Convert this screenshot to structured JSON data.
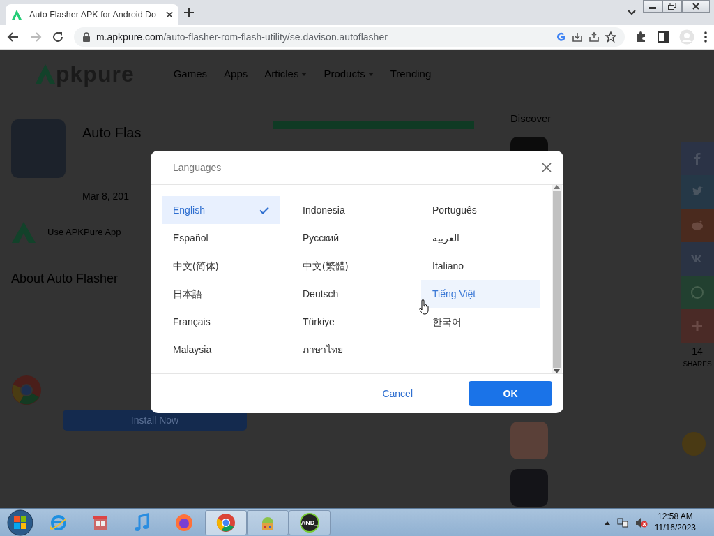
{
  "browser": {
    "tab_title": "Auto Flasher APK for Android Do",
    "url_host": "m.apkpure.com",
    "url_path": "/auto-flasher-rom-flash-utility/se.davison.autoflasher"
  },
  "page": {
    "logo": "pkpure",
    "nav": [
      {
        "label": "Games",
        "dropdown": false
      },
      {
        "label": "Apps",
        "dropdown": false
      },
      {
        "label": "Articles",
        "dropdown": true
      },
      {
        "label": "Products",
        "dropdown": true
      },
      {
        "label": "Trending",
        "dropdown": false
      }
    ],
    "app_title": "Auto Flas",
    "date": "Mar 8, 201",
    "use_app": "Use APKPure App",
    "about_heading": "About Auto Flasher",
    "install_button": "Install Now",
    "discover": "Discover",
    "share_buttons": [
      {
        "kind": "facebook",
        "color": "#2b3346"
      },
      {
        "kind": "twitter",
        "color": "#253847"
      },
      {
        "kind": "reddit",
        "color": "#4a2a1e"
      },
      {
        "kind": "vk",
        "color": "#2a3344"
      },
      {
        "kind": "whatsapp",
        "color": "#224030"
      },
      {
        "kind": "more",
        "color": "#4a2a26"
      }
    ],
    "share_count": "14",
    "share_label": "SHARES"
  },
  "dialog": {
    "title": "Languages",
    "languages": [
      {
        "label": "English",
        "selected": true,
        "hovered": false
      },
      {
        "label": "Indonesia",
        "selected": false,
        "hovered": false
      },
      {
        "label": "Português",
        "selected": false,
        "hovered": false
      },
      {
        "label": "Español",
        "selected": false,
        "hovered": false
      },
      {
        "label": "Русский",
        "selected": false,
        "hovered": false
      },
      {
        "label": "العربية",
        "selected": false,
        "hovered": false
      },
      {
        "label": "中文(简体)",
        "selected": false,
        "hovered": false
      },
      {
        "label": "中文(繁體)",
        "selected": false,
        "hovered": false
      },
      {
        "label": "Italiano",
        "selected": false,
        "hovered": false
      },
      {
        "label": "日本語",
        "selected": false,
        "hovered": false
      },
      {
        "label": "Deutsch",
        "selected": false,
        "hovered": false
      },
      {
        "label": "Tiếng Việt",
        "selected": false,
        "hovered": true
      },
      {
        "label": "Français",
        "selected": false,
        "hovered": false
      },
      {
        "label": "Türkiye",
        "selected": false,
        "hovered": false
      },
      {
        "label": "한국어",
        "selected": false,
        "hovered": false
      },
      {
        "label": "Malaysia",
        "selected": false,
        "hovered": false
      },
      {
        "label": "ภาษาไทย",
        "selected": false,
        "hovered": false
      }
    ],
    "cancel_button": "Cancel",
    "ok_button": "OK"
  },
  "taskbar": {
    "apps": [
      {
        "kind": "ie",
        "open": false,
        "active": false
      },
      {
        "kind": "store",
        "open": false,
        "active": false
      },
      {
        "kind": "music",
        "open": false,
        "active": false
      },
      {
        "kind": "firefox",
        "open": false,
        "active": false
      },
      {
        "kind": "chrome",
        "open": true,
        "active": true
      },
      {
        "kind": "android",
        "open": true,
        "active": false
      },
      {
        "kind": "terminal",
        "open": true,
        "active": false,
        "label": "AND_"
      }
    ],
    "clock_time": "12:58 AM",
    "clock_date": "11/16/2023"
  }
}
